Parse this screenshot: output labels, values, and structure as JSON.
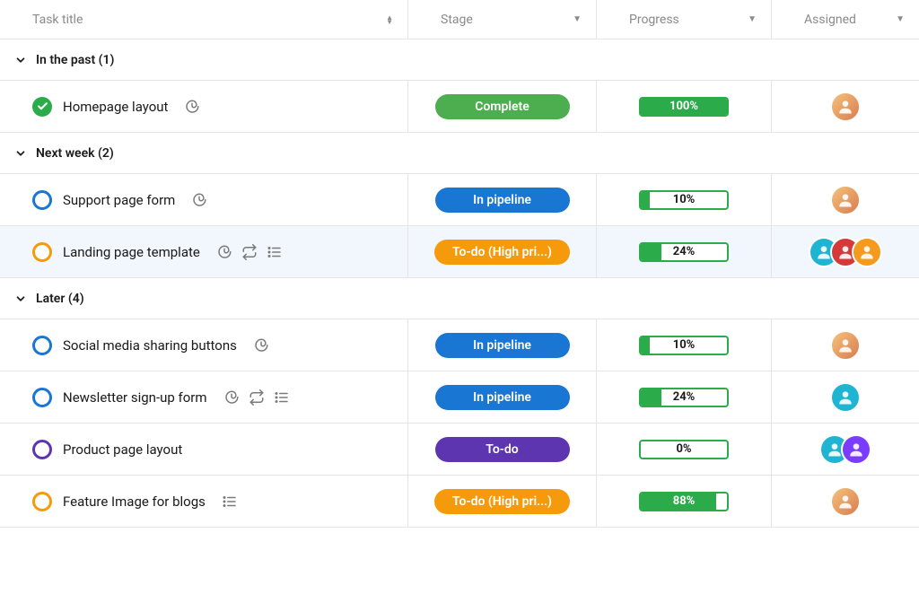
{
  "columns": {
    "task_title": "Task title",
    "stage": "Stage",
    "progress": "Progress",
    "assigned": "Assigned"
  },
  "stage_colors": {
    "complete": "#4cae4f",
    "in_pipeline": "#1976d2",
    "todo_high": "#f59b0b",
    "todo": "#5e35b1"
  },
  "ring_colors": {
    "blue": "#1976d2",
    "orange": "#f59b0b",
    "purple": "#5e35b1"
  },
  "groups": [
    {
      "label": "In the past (1)",
      "tasks": [
        {
          "title": "Homepage layout",
          "status": "complete",
          "icons": [
            "attachment"
          ],
          "stage_label": "Complete",
          "stage_color": "complete",
          "progress": 100,
          "progress_label": "100%",
          "assignees": [
            {
              "cls": "av-bg1"
            }
          ],
          "highlight": false
        }
      ]
    },
    {
      "label": "Next week (2)",
      "tasks": [
        {
          "title": "Support page form",
          "status": "ring",
          "ring_color": "blue",
          "icons": [
            "attachment"
          ],
          "stage_label": "In pipeline",
          "stage_color": "in_pipeline",
          "progress": 10,
          "progress_label": "10%",
          "assignees": [
            {
              "cls": "av-bg1"
            }
          ],
          "highlight": false
        },
        {
          "title": "Landing page template",
          "status": "ring",
          "ring_color": "orange",
          "icons": [
            "attachment",
            "repeat",
            "list"
          ],
          "stage_label": "To-do (High pri...)",
          "stage_color": "todo_high",
          "progress": 24,
          "progress_label": "24%",
          "assignees": [
            {
              "cls": "av-bg2"
            },
            {
              "cls": "av-bg3"
            },
            {
              "cls": "av-bg4"
            }
          ],
          "highlight": true
        }
      ]
    },
    {
      "label": "Later (4)",
      "tasks": [
        {
          "title": "Social media sharing buttons",
          "status": "ring",
          "ring_color": "blue",
          "icons": [
            "attachment"
          ],
          "stage_label": "In pipeline",
          "stage_color": "in_pipeline",
          "progress": 10,
          "progress_label": "10%",
          "assignees": [
            {
              "cls": "av-bg1"
            }
          ],
          "highlight": false
        },
        {
          "title": "Newsletter sign-up form",
          "status": "ring",
          "ring_color": "blue",
          "icons": [
            "attachment",
            "repeat",
            "list"
          ],
          "stage_label": "In pipeline",
          "stage_color": "in_pipeline",
          "progress": 24,
          "progress_label": "24%",
          "assignees": [
            {
              "cls": "av-bg2"
            }
          ],
          "highlight": false
        },
        {
          "title": "Product page layout",
          "status": "ring",
          "ring_color": "purple",
          "icons": [],
          "stage_label": "To-do",
          "stage_color": "todo",
          "progress": 0,
          "progress_label": "0%",
          "assignees": [
            {
              "cls": "av-bg2"
            },
            {
              "cls": "av-bg5"
            }
          ],
          "highlight": false
        },
        {
          "title": "Feature Image for blogs",
          "status": "ring",
          "ring_color": "orange",
          "icons": [
            "list"
          ],
          "stage_label": "To-do (High pri...)",
          "stage_color": "todo_high",
          "progress": 88,
          "progress_label": "88%",
          "assignees": [
            {
              "cls": "av-bg1"
            }
          ],
          "highlight": false
        }
      ]
    }
  ]
}
